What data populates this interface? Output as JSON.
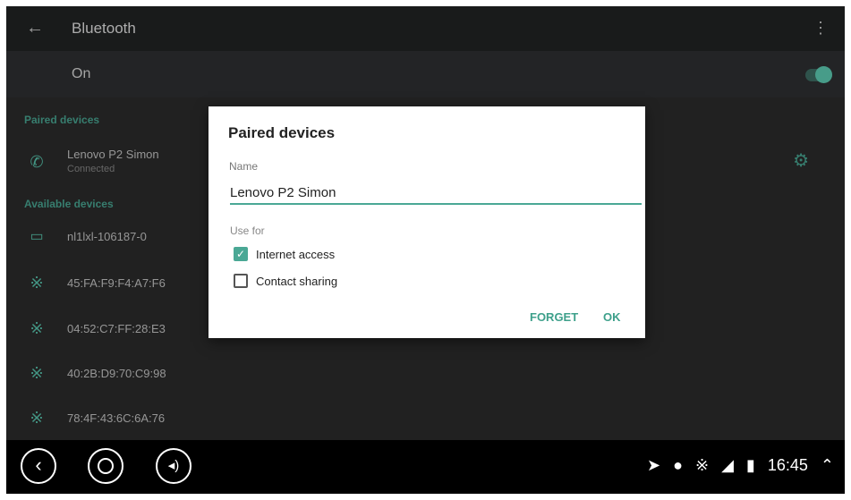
{
  "appbar": {
    "title": "Bluetooth",
    "back_icon": "back-arrow-icon",
    "menu_icon": "overflow-menu-icon"
  },
  "toggle": {
    "label": "On",
    "state": true,
    "accent": "#5fd1b7"
  },
  "paired_section": "Paired devices",
  "paired": [
    {
      "name": "Lenovo P2 Simon",
      "status": "Connected",
      "icon": "phone-icon"
    }
  ],
  "available_section": "Available devices",
  "available": [
    {
      "name": "nl1lxl-106187-0",
      "icon": "laptop-icon"
    },
    {
      "name": "45:FA:F9:F4:A7:F6",
      "icon": "bluetooth-icon"
    },
    {
      "name": "04:52:C7:FF:28:E3",
      "icon": "bluetooth-icon"
    },
    {
      "name": "40:2B:D9:70:C9:98",
      "icon": "bluetooth-icon"
    },
    {
      "name": "78:4F:43:6C:6A:76",
      "icon": "bluetooth-icon"
    }
  ],
  "dialog": {
    "title": "Paired devices",
    "name_label": "Name",
    "name_value": "Lenovo P2 Simon",
    "use_for_label": "Use for",
    "options": [
      {
        "label": "Internet access",
        "checked": true
      },
      {
        "label": "Contact sharing",
        "checked": false
      }
    ],
    "forget": "FORGET",
    "ok": "OK"
  },
  "status_bar": {
    "time": "16:45"
  }
}
